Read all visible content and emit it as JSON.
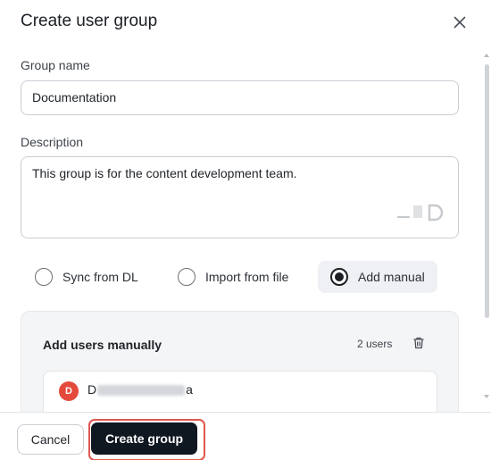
{
  "dialog": {
    "title": "Create user group",
    "close_icon": "close-icon"
  },
  "form": {
    "group_name_label": "Group name",
    "group_name_value": "Documentation",
    "description_label": "Description",
    "description_value": "This group is for the content development team."
  },
  "source_options": [
    {
      "label": "Sync from DL",
      "selected": false
    },
    {
      "label": "Import from file",
      "selected": false
    },
    {
      "label": "Add manual",
      "selected": true
    }
  ],
  "users_panel": {
    "title": "Add users manually",
    "count": "2 users",
    "trash_icon": "trash-icon",
    "users": [
      {
        "avatar_initial": "D",
        "name_start": "D",
        "name_end": "a",
        "avatar_color": "#e44a3b"
      }
    ]
  },
  "footer": {
    "cancel_label": "Cancel",
    "create_label": "Create group"
  },
  "colors": {
    "primary_button": "#0f1720",
    "highlight_border": "#e0564d"
  }
}
